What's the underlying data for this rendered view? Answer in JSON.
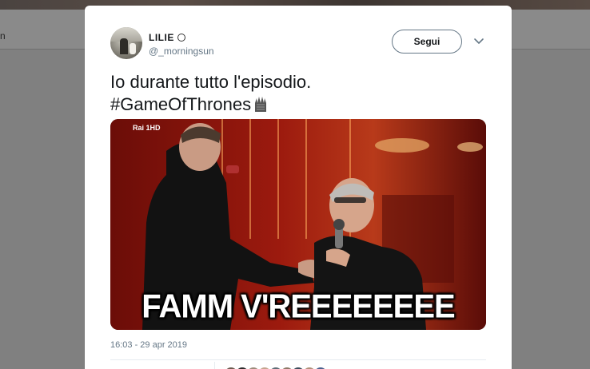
{
  "background": {
    "edge_text": "n"
  },
  "tweet": {
    "display_name": "LILIE",
    "handle": "@_morningsun",
    "follow_label": "Segui",
    "text": "Io durante tutto l'episodio.\n#GameOfThrones",
    "throne_emoji": "throne-icon",
    "media": {
      "caption": "FAMM V'REEEEEEEE",
      "channel_logo": "Rai 1HD"
    },
    "timestamp": "16:03 - 29 apr 2019"
  },
  "colors": {
    "text": "#14171a",
    "secondary": "#657786",
    "border": "#e6ecf0"
  },
  "liker_colors": [
    "#6b5a4e",
    "#2a2a2a",
    "#9b8a7a",
    "#c4a48e",
    "#5d6b75",
    "#8c7766",
    "#3c4b5a",
    "#b08f78",
    "#4a5f8c"
  ]
}
